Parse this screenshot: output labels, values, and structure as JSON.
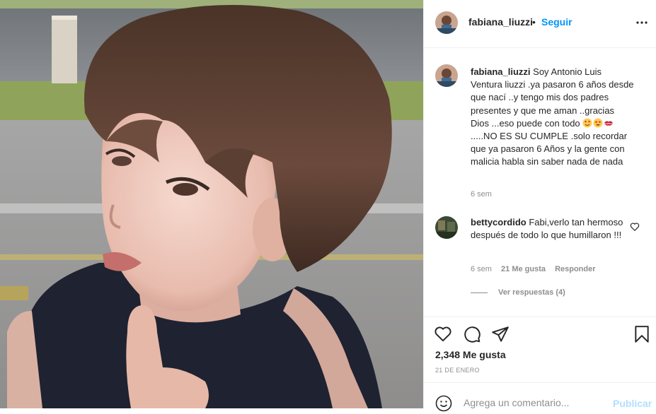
{
  "header": {
    "username": "fabiana_liuzzi",
    "separator": "•",
    "follow_label": "Seguir",
    "more_icon": "more-horizontal-icon"
  },
  "caption": {
    "username": "fabiana_liuzzi",
    "text_before_emoji": "Soy Antonio Luis Ventura liuzzi .ya pasaron 6 años desde que nací ..y tengo mis dos padres presentes y que me aman ..gracias Dios ...eso puede con todo",
    "emojis": [
      "smiling-face-with-heart-eyes",
      "star-struck",
      "kiss-mark"
    ],
    "text_after_emoji": ".....NO ES SU CUMPLE .solo recordar que ya pasaron 6 Años y la gente con malicia habla sin saber nada de nada",
    "time": "6 sem"
  },
  "reply": {
    "username": "bettycordido",
    "text": "Fabi,verlo tan hermoso después de todo lo que humillaron !!!",
    "time": "6 sem",
    "likes": "21 Me gusta",
    "respond_label": "Responder",
    "view_replies_label": "Ver respuestas (4)"
  },
  "actions": {
    "icons": [
      "heart-icon",
      "comment-icon",
      "share-icon",
      "bookmark-icon"
    ]
  },
  "likes_label": "2,348 Me gusta",
  "date_label": "21 DE ENERO",
  "add_comment": {
    "placeholder": "Agrega un comentario...",
    "publish_label": "Publicar"
  },
  "colors": {
    "link_blue": "#0095f6",
    "publish_disabled": "#b2dffc",
    "secondary_text": "#8e8e8e",
    "primary_text": "#262626",
    "divider": "#efefef"
  }
}
